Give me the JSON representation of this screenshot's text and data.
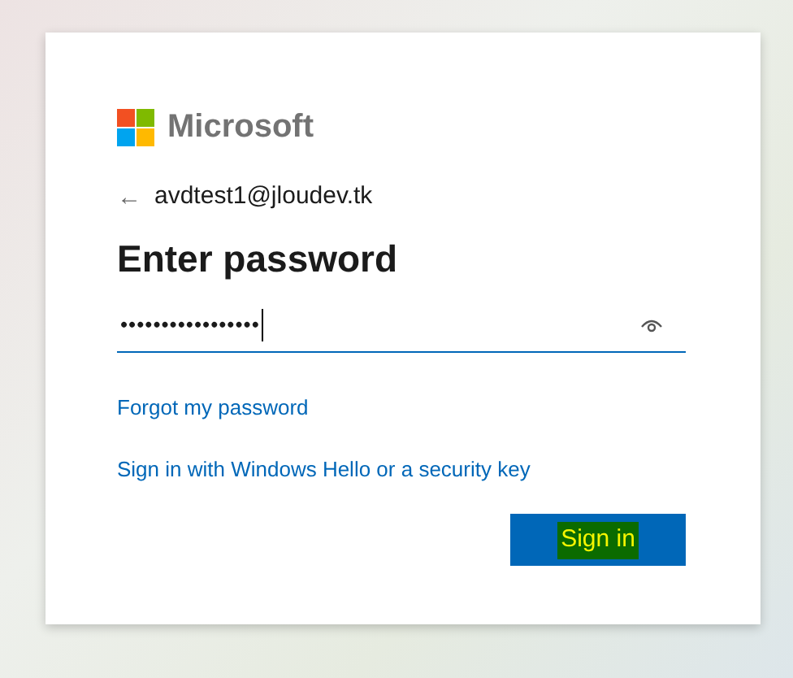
{
  "logo": {
    "text": "Microsoft"
  },
  "account": {
    "back": "←",
    "email": "avdtest1@jloudev.tk"
  },
  "title": "Enter password",
  "password_field": {
    "value": "•••••••••••••••••"
  },
  "links": [
    "Forgot my password",
    "Sign in with Windows Hello or a security key"
  ],
  "sign_in_button": {
    "label": "Sign in",
    "highlighted": true
  }
}
